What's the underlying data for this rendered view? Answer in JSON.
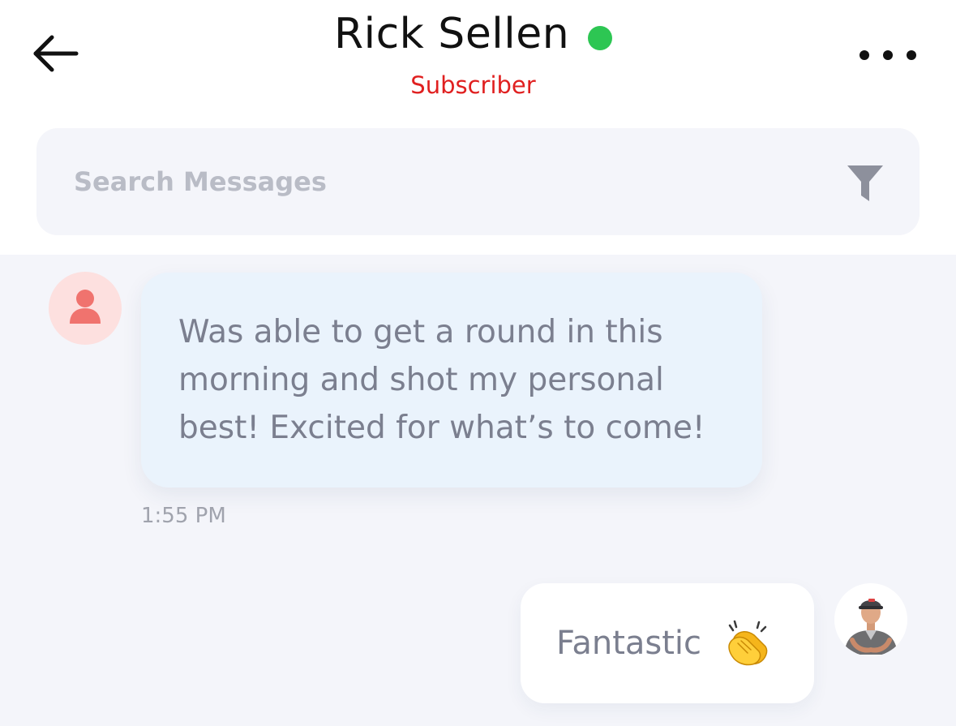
{
  "header": {
    "back_icon": "arrow-left-icon",
    "contact_name": "Rick Sellen",
    "status_color": "#2dc653",
    "contact_role": "Subscriber",
    "more_icon": "more-horizontal-icon"
  },
  "search": {
    "placeholder": "Search Messages",
    "value": "",
    "filter_icon": "filter-icon"
  },
  "conversation": {
    "messages": [
      {
        "direction": "incoming",
        "avatar_icon": "user-icon",
        "text": "Was able to get a round in this morning and shot my personal best! Excited for what’s to come!",
        "time": "1:55 PM"
      },
      {
        "direction": "outgoing",
        "avatar": "user-photo",
        "text": "Fantastic",
        "emoji": "clapping-hands-icon",
        "time": ""
      }
    ]
  },
  "colors": {
    "accent_red": "#e02020",
    "online_green": "#2dc653",
    "chat_background": "#f4f5fa",
    "incoming_bubble": "#eaf3fc",
    "outgoing_bubble": "#ffffff"
  }
}
